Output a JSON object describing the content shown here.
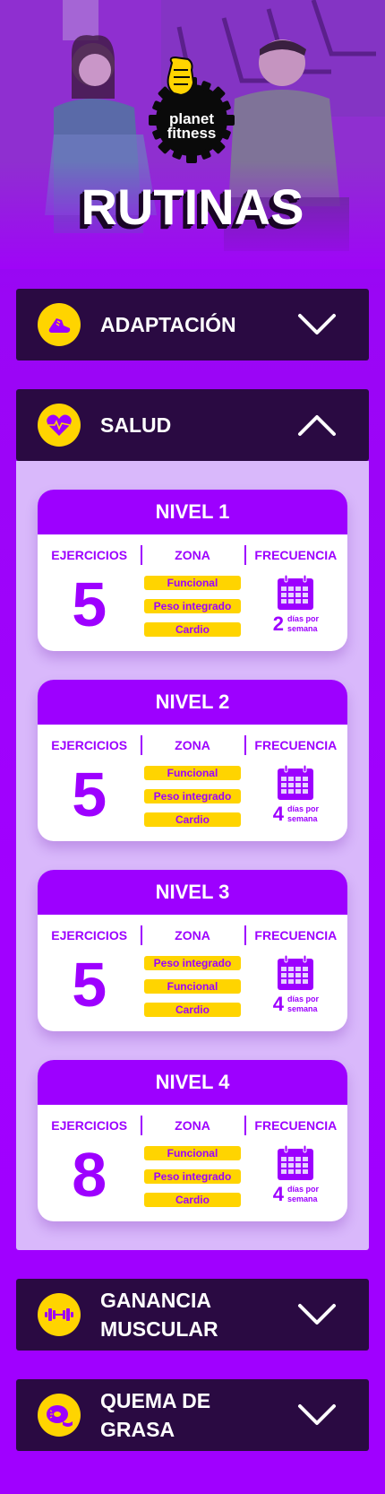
{
  "brand": {
    "logo_line1": "planet",
    "logo_line2": "fitness"
  },
  "page": {
    "title": "RUTINAS"
  },
  "labels": {
    "col_ejercicios": "EJERCICIOS",
    "col_zona": "ZONA",
    "col_frecuencia": "FRECUENCIA",
    "dias_por": "días por",
    "semana": "semana"
  },
  "sections": [
    {
      "label": "ADAPTACIÓN",
      "icon": "sneaker-icon",
      "expanded": false
    },
    {
      "label": "SALUD",
      "icon": "heart-pulse-icon",
      "expanded": true
    },
    {
      "label": "GANANCIA MUSCULAR",
      "icon": "dumbbell-icon",
      "expanded": false
    },
    {
      "label": "QUEMA DE GRASA",
      "icon": "tape-measure-icon",
      "expanded": false
    }
  ],
  "levels": [
    {
      "title": "NIVEL 1",
      "ejercicios": "5",
      "zonas": [
        "Funcional",
        "Peso integrado",
        "Cardio"
      ],
      "dias": "2"
    },
    {
      "title": "NIVEL 2",
      "ejercicios": "5",
      "zonas": [
        "Funcional",
        "Peso integrado",
        "Cardio"
      ],
      "dias": "4"
    },
    {
      "title": "NIVEL 3",
      "ejercicios": "5",
      "zonas": [
        "Peso integrado",
        "Funcional",
        "Cardio"
      ],
      "dias": "4"
    },
    {
      "title": "NIVEL 4",
      "ejercicios": "8",
      "zonas": [
        "Funcional",
        "Peso integrado",
        "Cardio"
      ],
      "dias": "4"
    }
  ],
  "colors": {
    "primary_purple": "#9d00ff",
    "dark_header": "#2a0a42",
    "accent_yellow": "#ffd400",
    "panel_lilac": "#d9b8fb"
  }
}
